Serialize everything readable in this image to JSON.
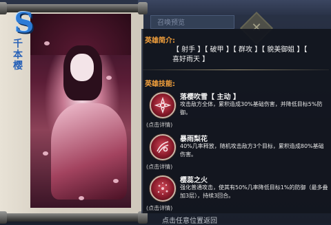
{
  "background": {
    "tab_label": "召唤预览",
    "close_glyph": "✕"
  },
  "hero": {
    "rank_letter": "S",
    "name_chars": [
      "千",
      "本",
      "樱"
    ]
  },
  "intro": {
    "title": "英雄简介:",
    "tags_line1": "【 射手 】【 破甲 】【 群攻 】【 貌美御姐 】【",
    "tags_line2": "喜好雨天 】"
  },
  "skills_section": {
    "title": "英雄技能:",
    "skills": [
      {
        "icon": "sakura-flower-icon",
        "name": "落樱吹雪【 主动 】",
        "desc": "攻击敌方全体，累积造成30%基础伤害，并降低目标5%防御。",
        "detail": "(点击详情)"
      },
      {
        "icon": "bloom-burst-icon",
        "name": "暴雨梨花",
        "desc": "40%几率释放，随机攻击敌方3个目标，累积造成80%基础伤害。",
        "detail": "(点击详情)"
      },
      {
        "icon": "fire-petal-icon",
        "name": "樱蕊之火",
        "desc": "强化普通攻击，使其有50%几率降低目标1%的防御（最多叠加3层），持续3回合。",
        "detail": "(点击详情)"
      }
    ]
  },
  "footer": {
    "text": "点击任意位置返回"
  },
  "colors": {
    "section_title": "#f2a03c",
    "rank_blue": "#2d7bd6"
  }
}
